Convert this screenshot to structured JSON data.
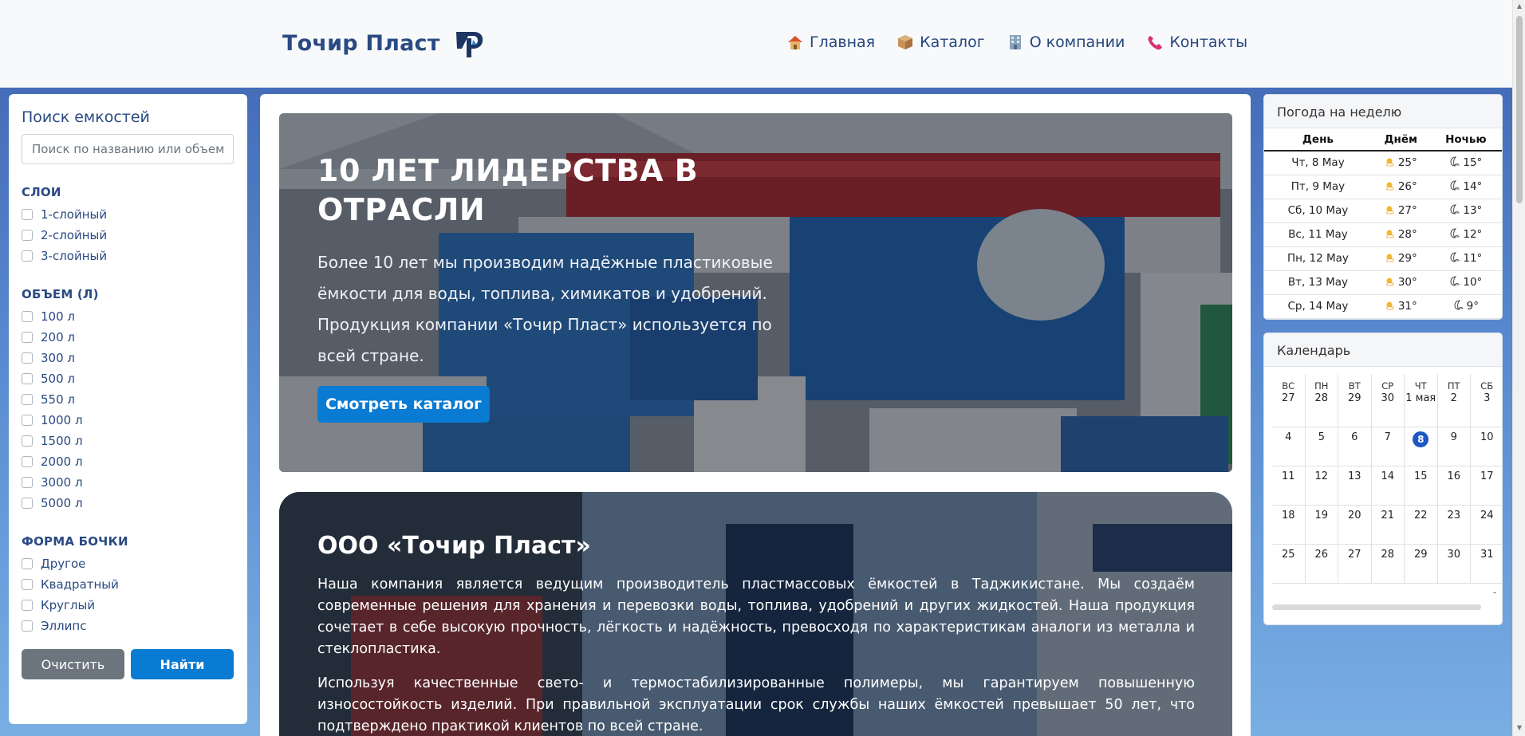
{
  "header": {
    "brand": "Точир Пласт",
    "nav": [
      {
        "label": "Главная",
        "icon": "house-icon"
      },
      {
        "label": "Каталог",
        "icon": "package-icon"
      },
      {
        "label": "О компании",
        "icon": "office-building-icon"
      },
      {
        "label": "Контакты",
        "icon": "phone-icon"
      }
    ]
  },
  "filters": {
    "title": "Поиск емкостей",
    "search_placeholder": "Поиск по названию или объему",
    "layers": {
      "title": "СЛОИ",
      "options": [
        "1-слойный",
        "2-слойный",
        "3-слойный"
      ]
    },
    "volume": {
      "title": "ОБЪЕМ (Л)",
      "options": [
        "100 л",
        "200 л",
        "300 л",
        "500 л",
        "550 л",
        "1000 л",
        "1500 л",
        "2000 л",
        "3000 л",
        "5000 л"
      ]
    },
    "shape": {
      "title": "ФОРМА БОЧКИ",
      "options": [
        "Другое",
        "Квадратный",
        "Круглый",
        "Эллипс"
      ]
    },
    "clear_label": "Очистить",
    "find_label": "Найти"
  },
  "hero": {
    "title": "10 ЛЕТ ЛИДЕРСТВА В ОТРАСЛИ",
    "text": "Более 10 лет мы производим надёжные пластиковые ёмкости для воды, топлива, химикатов и удобрений. Продукция компании «Точир Пласт» используется по всей стране.",
    "button": "Смотреть каталог"
  },
  "about": {
    "title": "ООО «Точир Пласт»",
    "p1": "Наша компания является ведущим производитель пластмассовых ёмкостей в Таджикистане. Мы создаём современные решения для хранения и перевозки воды, топлива, удобрений и других жидкостей. Наша продукция сочетает в себе высокую прочность, лёгкость и надёжность, превосходя по характеристикам аналоги из металла и стеклопластика.",
    "p2": "Используя качественные свето- и термостабилизированные полимеры, мы гарантируем повышенную износостойкость изделий. При правильной эксплуатации срок службы наших ёмкостей превышает 50 лет, что подтверждено практикой клиентов по всей стране."
  },
  "weather": {
    "title": "Погода на неделю",
    "headers": [
      "День",
      "Днём",
      "Ночью"
    ],
    "rows": [
      {
        "day": "Чт, 8 May",
        "day_temp": "25°",
        "night_temp": "15°"
      },
      {
        "day": "Пт, 9 May",
        "day_temp": "26°",
        "night_temp": "14°"
      },
      {
        "day": "Сб, 10 May",
        "day_temp": "27°",
        "night_temp": "13°"
      },
      {
        "day": "Вс, 11 May",
        "day_temp": "28°",
        "night_temp": "12°"
      },
      {
        "day": "Пн, 12 May",
        "day_temp": "29°",
        "night_temp": "11°"
      },
      {
        "day": "Вт, 13 May",
        "day_temp": "30°",
        "night_temp": "10°"
      },
      {
        "day": "Ср, 14 May",
        "day_temp": "31°",
        "night_temp": "9°"
      }
    ]
  },
  "calendar": {
    "title": "Календарь",
    "weekdays": [
      "ВС",
      "ПН",
      "ВТ",
      "СР",
      "ЧТ",
      "ПТ",
      "СБ"
    ],
    "first_row": [
      "27",
      "28",
      "29",
      "30",
      "1 мая",
      "2",
      "3"
    ],
    "weeks": [
      [
        "4",
        "5",
        "6",
        "7",
        "8",
        "9",
        "10"
      ],
      [
        "11",
        "12",
        "13",
        "14",
        "15",
        "16",
        "17"
      ],
      [
        "18",
        "19",
        "20",
        "21",
        "22",
        "23",
        "24"
      ],
      [
        "25",
        "26",
        "27",
        "28",
        "29",
        "30",
        "31"
      ]
    ],
    "today": "8",
    "more": "-"
  },
  "colors": {
    "accent": "#0a7bd2",
    "brand": "#2a4a82",
    "today": "#1c57c4"
  }
}
